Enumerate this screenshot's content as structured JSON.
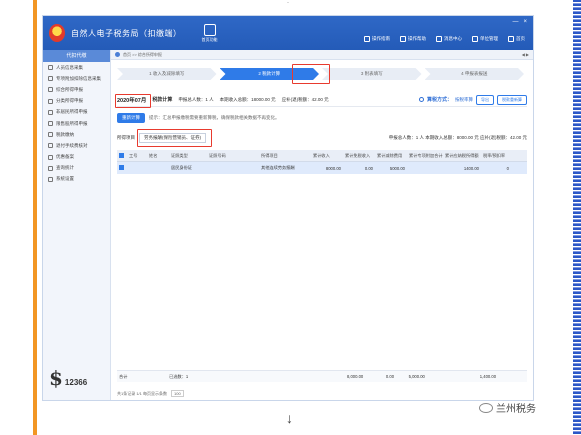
{
  "app": {
    "title": "自然人电子税务局（扣缴端）",
    "home_label": "首页功能",
    "toolbar": [
      "操作指南",
      "操作帮助",
      "消息中心",
      "单位管理",
      "首页"
    ],
    "window_controls": [
      "—",
      "×"
    ]
  },
  "sidebar": {
    "header": "代扣代缴",
    "items": [
      "人员信息采集",
      "专项附加扣除信息采集",
      "综合所得申报",
      "分类所得申报",
      "非居民所得申报",
      "限售股所得申报",
      "税款缴纳",
      "退付手续费核对",
      "优惠备案",
      "查询统计",
      "系统设置"
    ],
    "logo_text": "12366"
  },
  "breadcrumb": {
    "path": "首页 >> 综合所得申报",
    "tab_close": "◀ ▶"
  },
  "steps": [
    "1 收入及减除填写",
    "2 税款计算",
    "3 附表填写",
    "4 申报表报送"
  ],
  "period": {
    "date": "2020年07月",
    "calc_label": "税款计算",
    "people_label": "申报总人数：1 人",
    "income_label": "本期收入总额：18000.00 元",
    "tax_label": "应补(退)税额：42.00 元"
  },
  "method": {
    "label": "算税方式：",
    "value": "按税率算",
    "export_button": "导出",
    "recalc_button": "税款重新算"
  },
  "tool": {
    "recalc_button": "重新计算",
    "hint": "提示：汇总申报缴税需要重新算税，确保税款相关数据不再变化。"
  },
  "filter": {
    "label": "所得项目",
    "select_value": "劳务报酬(保险营销员、证券)",
    "summary": "申报总人数：1 人   本期收入总额：8000.00 元   应补(退)税额：42.00 元"
  },
  "table": {
    "columns": [
      "",
      "工号",
      "姓名",
      "证照类型",
      "证照号码",
      "所得项目",
      "累计收入",
      "累计免税收入",
      "累计减除费用",
      "累计专项附加合计",
      "累计应纳税所得额",
      "税率/预扣率"
    ],
    "rows": [
      [
        "",
        "",
        "",
        "居民身份证",
        "",
        "其他连续劳务报酬",
        "8000.00",
        "0.00",
        "5000.00",
        "",
        "1400.00",
        "0"
      ]
    ],
    "footer": [
      "合计",
      "",
      "已选数：1",
      "",
      "",
      "",
      "8,000.00",
      "0.00",
      "5,000.00",
      "",
      "1,400.00",
      ""
    ]
  },
  "pagination": {
    "text": "共1条记录  1/1  每页显示条数",
    "size": "100"
  },
  "watermark": "兰州税务"
}
